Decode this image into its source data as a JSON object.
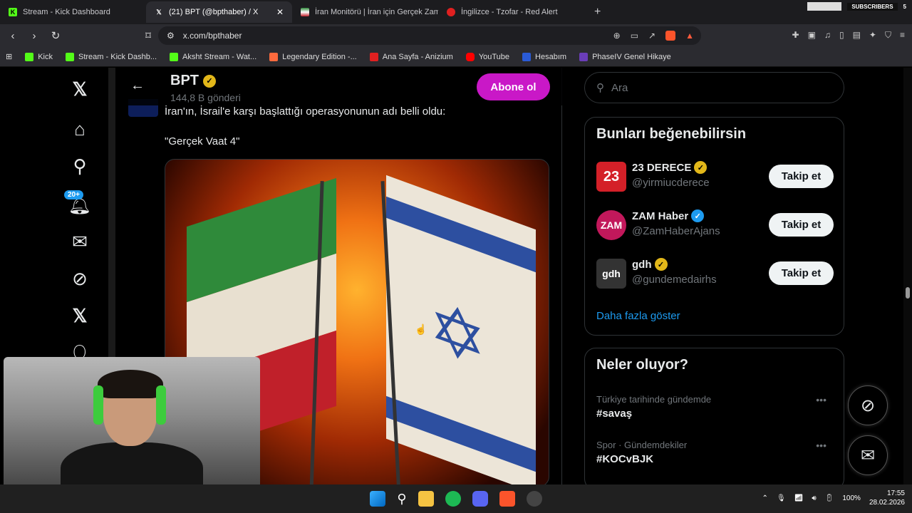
{
  "browser": {
    "tabs": [
      {
        "title": "Stream - Kick Dashboard",
        "icon": "kick-icon",
        "active": false
      },
      {
        "title": "(21) BPT (@bpthaber) / X",
        "icon": "x-icon",
        "active": true
      },
      {
        "title": "İran Monitörü | İran için Gerçek Zama",
        "icon": "flag-icon",
        "active": false
      },
      {
        "title": "İngilizce - Tzofar - Red Alert",
        "icon": "alert-icon",
        "active": false
      }
    ],
    "subscribers_label": "SUBSCRIBERS",
    "subscribers_count": "5",
    "url": "x.com/bpthaber",
    "bookmarks": [
      {
        "label": "Kick",
        "color": "#53fc18"
      },
      {
        "label": "Stream - Kick Dashb...",
        "color": "#53fc18"
      },
      {
        "label": "Aksht Stream - Wat...",
        "color": "#53fc18"
      },
      {
        "label": "Legendary Edition -...",
        "color": "#ff6a3d"
      },
      {
        "label": "Ana Sayfa - Anizium",
        "color": "#e02020"
      },
      {
        "label": "YouTube",
        "color": "#ff0000"
      },
      {
        "label": "Hesabım",
        "color": "#2a5bd7"
      },
      {
        "label": "PhaseIV Genel Hikaye",
        "color": "#6a3db8"
      }
    ]
  },
  "sidebar": {
    "notification_badge": "20+"
  },
  "profile": {
    "name": "BPT",
    "post_count": "144,8 B gönderi",
    "subscribe_label": "Abone ol"
  },
  "post": {
    "text": "İran'ın, İsrail'e karşı başlattığı operasyonunun adı belli oldu:",
    "quote": "\"Gerçek Vaat 4\""
  },
  "search": {
    "placeholder": "Ara"
  },
  "suggestions": {
    "title": "Bunları beğenebilirsin",
    "items": [
      {
        "name": "23 DERECE",
        "handle": "@yirmiucderece",
        "avatar_text": "23",
        "avatar_color": "#d42028",
        "verified": "gold"
      },
      {
        "name": "ZAM Haber",
        "handle": "@ZamHaberAjans",
        "avatar_text": "ZAM",
        "avatar_color": "#c2185b",
        "verified": "blue"
      },
      {
        "name": "gdh",
        "handle": "@gundemedairhs",
        "avatar_text": "gdh",
        "avatar_color": "#333333",
        "verified": "gold"
      }
    ],
    "follow_label": "Takip et",
    "show_more": "Daha fazla göster"
  },
  "trends": {
    "title": "Neler oluyor?",
    "items": [
      {
        "meta": "Türkiye tarihinde gündemde",
        "tag": "#savaş"
      },
      {
        "meta": "Spor · Gündemdekiler",
        "tag": "#KOCvBJK"
      }
    ]
  },
  "taskbar": {
    "battery": "100%",
    "time": "17:55",
    "date": "28.02.2026"
  }
}
